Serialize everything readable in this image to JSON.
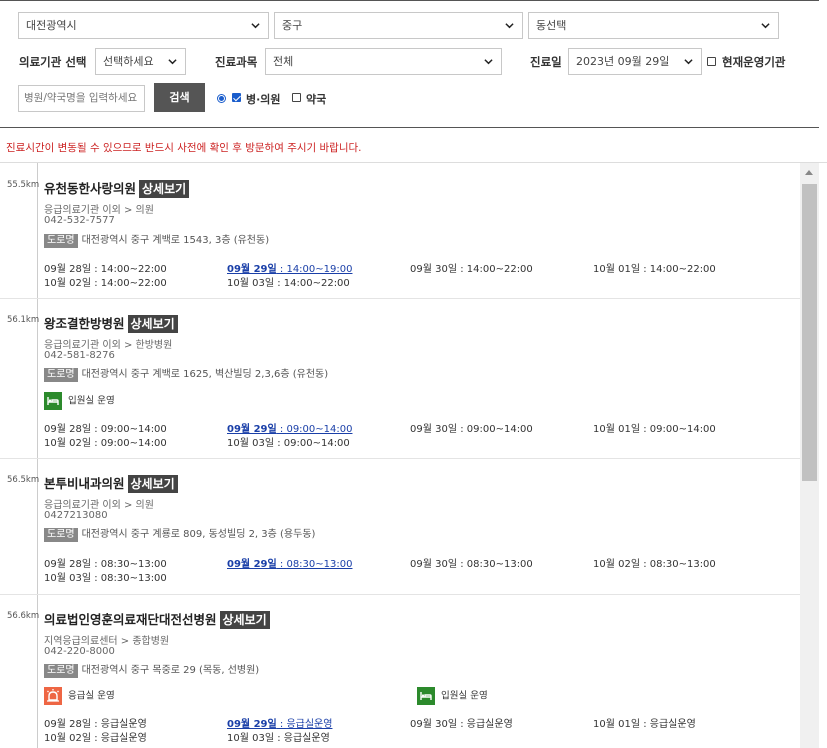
{
  "search": {
    "region1": "대전광역시",
    "region2": "중구",
    "region3": "동선택",
    "type_label": "의료기관 선택",
    "type_value": "선택하세요",
    "dept_label": "진료과목",
    "dept_value": "전체",
    "date_label": "진료일",
    "date_value": "2023년 09월 29일",
    "open_now_label": "현재운영기관",
    "keyword_placeholder": "병원/약국명을 입력하세요",
    "search_button": "검색",
    "opt_hospital": "병·의원",
    "opt_pharmacy": "약국"
  },
  "notice": "진료시간이 변동될 수 있으므로 반드시 사전에 확인 후 방문하여 주시기 바랍니다.",
  "detail_label": "상세보기",
  "road_label": "도로명",
  "facilities": [
    {
      "distance": "55.5km",
      "name": "유천동한사랑의원",
      "category": "응급의료기관 이외 > 의원",
      "phone": "042-532-7577",
      "address": "대전광역시 중구 계백로 1543, 3층 (유천동)",
      "services": [],
      "hours": [
        {
          "date": "09월 28일",
          "time": "14:00~22:00"
        },
        {
          "date": "09월 29일",
          "time": "14:00~19:00",
          "today": true
        },
        {
          "date": "09월 30일",
          "time": "14:00~22:00"
        },
        {
          "date": "10월 01일",
          "time": "14:00~22:00"
        },
        {
          "date": "10월 02일",
          "time": "14:00~22:00"
        },
        {
          "date": "10월 03일",
          "time": "14:00~22:00"
        }
      ]
    },
    {
      "distance": "56.1km",
      "name": "왕조결한방병원",
      "category": "응급의료기관 이외 > 한방병원",
      "phone": "042-581-8276",
      "address": "대전광역시 중구 계백로 1625, 벽산빌딩 2,3,6층 (유천동)",
      "services": [
        {
          "icon": "bed-icon",
          "label": "입원실 운영",
          "color": "#2c8a2c"
        }
      ],
      "hours": [
        {
          "date": "09월 28일",
          "time": "09:00~14:00"
        },
        {
          "date": "09월 29일",
          "time": "09:00~14:00",
          "today": true
        },
        {
          "date": "09월 30일",
          "time": "09:00~14:00"
        },
        {
          "date": "10월 01일",
          "time": "09:00~14:00"
        },
        {
          "date": "10월 02일",
          "time": "09:00~14:00"
        },
        {
          "date": "10월 03일",
          "time": "09:00~14:00"
        }
      ]
    },
    {
      "distance": "56.5km",
      "name": "본투비내과의원",
      "category": "응급의료기관 이외 > 의원",
      "phone": "0427213080",
      "address": "대전광역시 중구 계룡로 809, 동성빌딩 2, 3층 (용두동)",
      "services": [],
      "hours": [
        {
          "date": "09월 28일",
          "time": "08:30~13:00"
        },
        {
          "date": "09월 29일",
          "time": "08:30~13:00",
          "today": true
        },
        {
          "date": "09월 30일",
          "time": "08:30~13:00"
        },
        {
          "date": "10월 02일",
          "time": "08:30~13:00"
        },
        {
          "date": "10월 03일",
          "time": "08:30~13:00"
        }
      ]
    },
    {
      "distance": "56.6km",
      "name": "의료법인영훈의료재단대전선병원",
      "category": "지역응급의료센터 > 종합병원",
      "phone": "042-220-8000",
      "address": "대전광역시 중구 목중로 29 (목동, 선병원)",
      "services": [
        {
          "icon": "siren-icon",
          "label": "응급실 운영",
          "color": "#ee6644"
        },
        {
          "icon": "bed-icon",
          "label": "입원실 운영",
          "color": "#2c8a2c"
        }
      ],
      "hours": [
        {
          "date": "09월 28일",
          "time": "응급실운영"
        },
        {
          "date": "09월 29일",
          "time": "응급실운영",
          "today": true
        },
        {
          "date": "09월 30일",
          "time": "응급실운영"
        },
        {
          "date": "10월 01일",
          "time": "응급실운영"
        },
        {
          "date": "10월 02일",
          "time": "응급실운영"
        },
        {
          "date": "10월 03일",
          "time": "응급실운영"
        }
      ]
    }
  ]
}
